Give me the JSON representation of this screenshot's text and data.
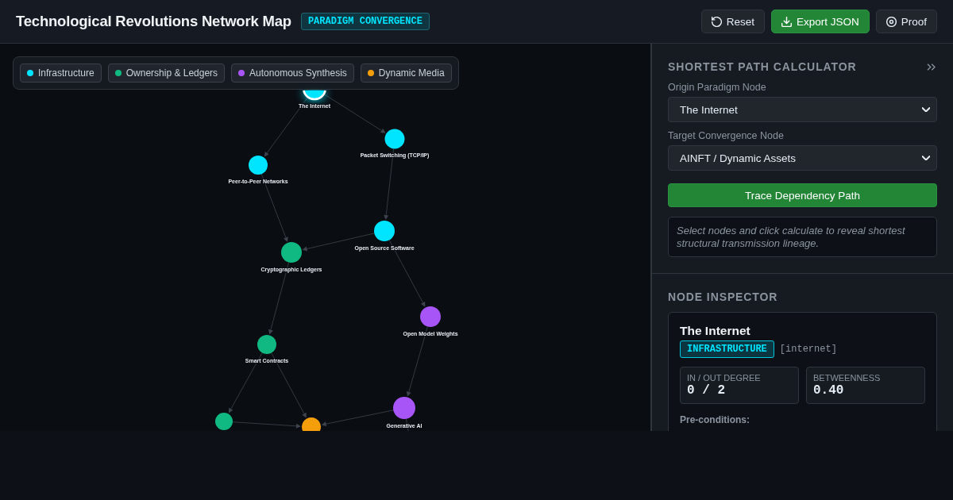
{
  "header": {
    "title": "Technological Revolutions Network Map",
    "badge": "PARADIGM CONVERGENCE",
    "buttons": [
      {
        "label": "Reset",
        "kind": "reset",
        "primary": false
      },
      {
        "label": "Export JSON",
        "kind": "export",
        "primary": true
      },
      {
        "label": "Proof",
        "kind": "proof",
        "primary": false
      }
    ]
  },
  "legend": [
    {
      "label": "Infrastructure",
      "color": "#00e5ff"
    },
    {
      "label": "Ownership & Ledgers",
      "color": "#10b981"
    },
    {
      "label": "Autonomous Synthesis",
      "color": "#a855f7"
    },
    {
      "label": "Dynamic Media",
      "color": "#f59e0b"
    }
  ],
  "graph": {
    "nodes": [
      {
        "label": "The Internet",
        "color": "#00e5ff",
        "selected": true
      },
      {
        "label": "Packet Switching (TCP/IP)",
        "color": "#00e5ff",
        "selected": false
      },
      {
        "label": "Peer-to-Peer Networks",
        "color": "#00e5ff",
        "selected": false
      },
      {
        "label": "Open Source Software",
        "color": "#00e5ff",
        "selected": false
      },
      {
        "label": "Cryptographic Ledgers",
        "color": "#10b981",
        "selected": false
      },
      {
        "label": "Open Model Weights",
        "color": "#a855f7",
        "selected": false
      },
      {
        "label": "Smart Contracts",
        "color": "#10b981",
        "selected": false
      },
      {
        "label": "Generative AI",
        "color": "#a855f7",
        "selected": false
      },
      {
        "color": "#10b981",
        "selected": false
      },
      {
        "color": "#f59e0b",
        "selected": false
      }
    ]
  },
  "path_calculator": {
    "title": "SHORTEST PATH CALCULATOR",
    "fields": [
      {
        "label": "Origin Paradigm Node",
        "value": "The Internet"
      },
      {
        "label": "Target Convergence Node",
        "value": "AINFT / Dynamic Assets"
      }
    ],
    "action": "Trace Dependency Path",
    "hint": "Select nodes and click calculate to reveal shortest structural transmission lineage."
  },
  "inspector": {
    "title": "NODE INSPECTOR",
    "node_name": "The Internet",
    "category": "INFRASTRUCTURE",
    "node_id": "[internet]",
    "stats": [
      {
        "label": "IN / OUT DEGREE",
        "value": "0 / 2"
      },
      {
        "label": "BETWEENNESS",
        "value": "0.40"
      }
    ],
    "preconditions_label": "Pre-conditions:"
  }
}
